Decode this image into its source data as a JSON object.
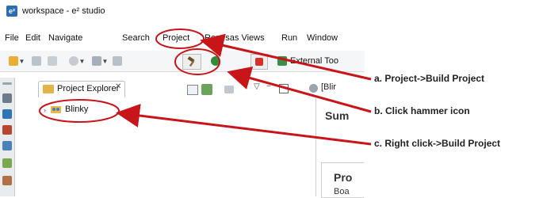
{
  "window": {
    "title": "workspace - e² studio",
    "logo": "e²"
  },
  "menu": [
    "File",
    "Edit",
    "Navigate",
    "Search",
    "Project",
    "Renesas Views",
    "Run",
    "Window"
  ],
  "toolbar": {
    "external_tools_label": "External Too"
  },
  "explorer": {
    "tab_label": "Project Explorer",
    "close_glyph": "✕",
    "tree_item": "Blinky",
    "chevron": "›"
  },
  "editor": {
    "tab_label": "[Blir",
    "summary_label": "Sum",
    "project_label": "Pro",
    "board_label": "Boa"
  },
  "annotations": {
    "a": "a. Project->Build Project",
    "b": "b. Click hammer icon",
    "c": "c. Right click->Build Project"
  },
  "colors": {
    "annotation_red": "#c7151a",
    "accent_blue": "#2a6db5"
  }
}
